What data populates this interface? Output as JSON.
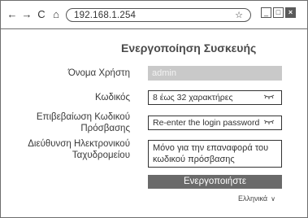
{
  "browser": {
    "back_icon": "arrow-left-icon",
    "forward_icon": "arrow-right-icon",
    "reload_icon": "reload-icon",
    "home_icon": "home-icon",
    "url": "192.168.1.254",
    "bookmark_icon": "star-icon",
    "minimize_label": "_",
    "maximize_label": "□",
    "close_label": "×"
  },
  "page": {
    "title": "Ενεργοποίηση Συσκευής"
  },
  "form": {
    "username_label": "Όνομα Χρήστη",
    "username_value": "admin",
    "password_label": "Κωδικός",
    "password_placeholder": "8 έως 32 χαρακτήρες",
    "confirm_label_line1": "Επιβεβαίωση Κωδικού",
    "confirm_label_line2": "Πρόσβασης",
    "confirm_placeholder": "Re-enter the login password",
    "email_label_line1": "Διεύθυνση Ηλεκτρονικού",
    "email_label_line2": "Ταχυδρομείου",
    "email_placeholder": "Μόνο για την επαναφορά του κωδικού πρόσβασης",
    "show_password_icon": "eye-closed-icon"
  },
  "actions": {
    "activate_label": "Ενεργοποιήστε"
  },
  "language": {
    "selected": "Ελληνικά"
  }
}
